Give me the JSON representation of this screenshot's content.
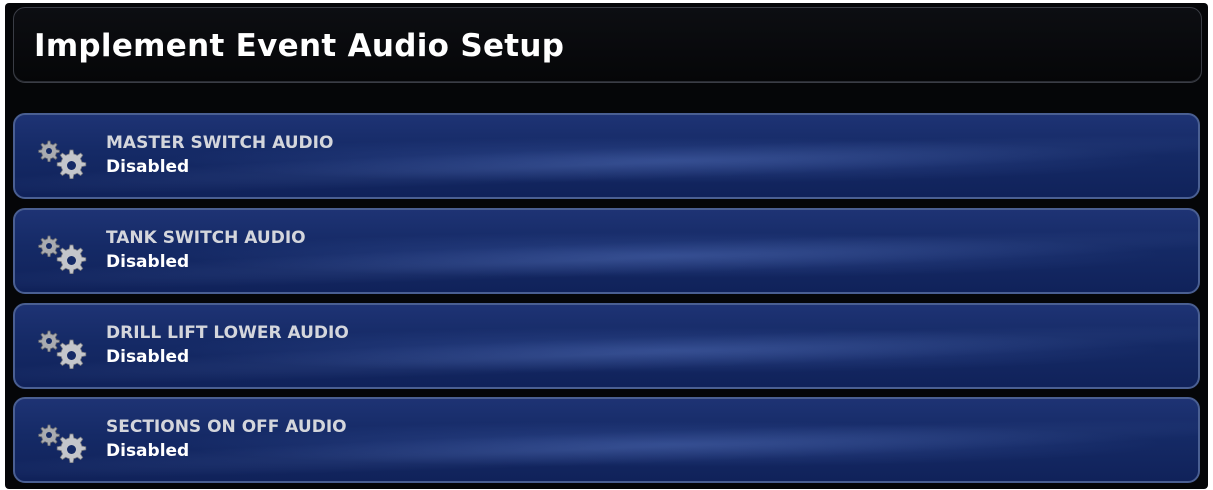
{
  "header": {
    "title": "Implement Event Audio Setup"
  },
  "settings": [
    {
      "label": "MASTER SWITCH AUDIO",
      "value": "Disabled",
      "icon": "gears-icon"
    },
    {
      "label": "TANK SWITCH AUDIO",
      "value": "Disabled",
      "icon": "gears-icon"
    },
    {
      "label": "DRILL LIFT LOWER AUDIO",
      "value": "Disabled",
      "icon": "gears-icon"
    },
    {
      "label": "SECTIONS ON OFF AUDIO",
      "value": "Disabled",
      "icon": "gears-icon"
    }
  ],
  "colors": {
    "background": "#050608",
    "row_fill": "#152a66",
    "row_border": "#4a5f92",
    "label_text": "#d4d6dc",
    "value_text": "#ffffff"
  }
}
